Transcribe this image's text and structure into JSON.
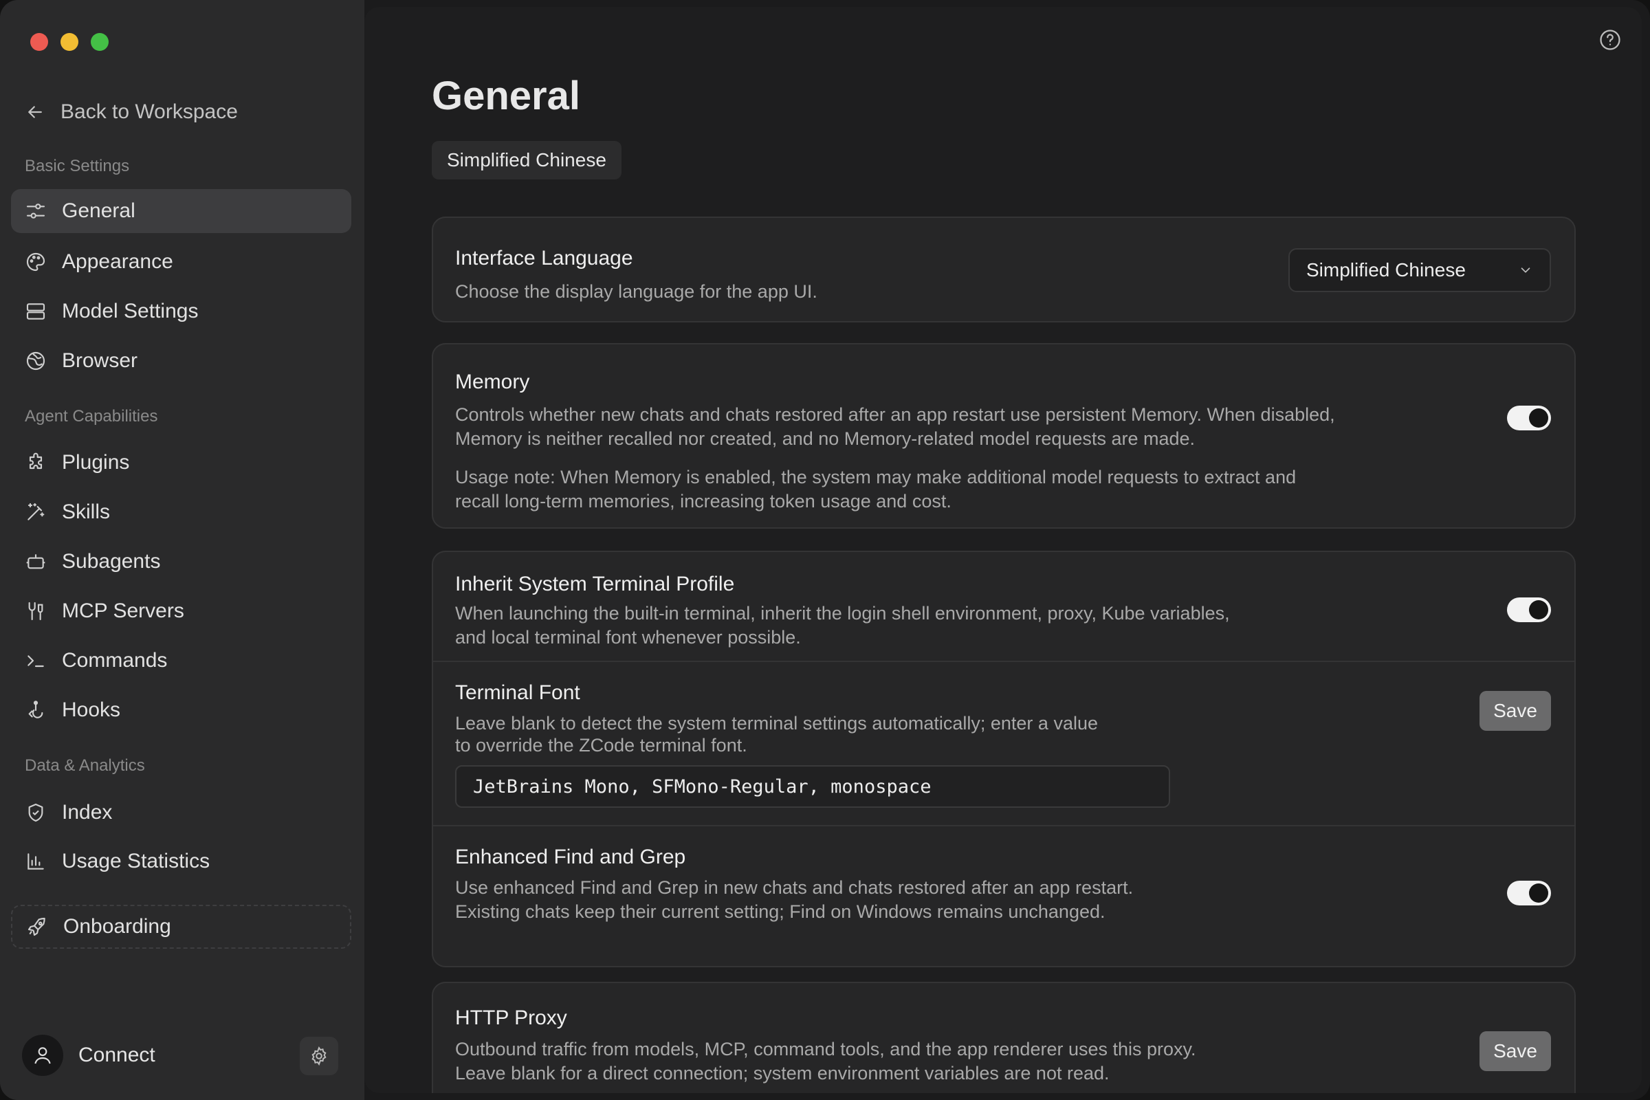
{
  "sidebar": {
    "back_label": "Back to Workspace",
    "sections": {
      "basic": "Basic Settings",
      "agent": "Agent Capabilities",
      "data": "Data & Analytics"
    },
    "items": {
      "general": "General",
      "appearance": "Appearance",
      "model_settings": "Model Settings",
      "browser": "Browser",
      "plugins": "Plugins",
      "skills": "Skills",
      "subagents": "Subagents",
      "mcp_servers": "MCP Servers",
      "commands": "Commands",
      "hooks": "Hooks",
      "index": "Index",
      "usage_statistics": "Usage Statistics",
      "onboarding": "Onboarding"
    },
    "active_item": "General",
    "connect_label": "Connect"
  },
  "main": {
    "title": "General",
    "language_chip": "Simplified Chinese",
    "interface_language": {
      "title": "Interface Language",
      "description": "Choose the display language for the app UI.",
      "selected": "Simplified Chinese"
    },
    "memory": {
      "title": "Memory",
      "description_line1": "Controls whether new chats and chats restored after an app restart use persistent Memory. When disabled,",
      "description_line2": "Memory is neither recalled nor created, and no Memory-related model requests are made.",
      "note_line1": "Usage note: When Memory is enabled, the system may make additional model requests to extract and",
      "note_line2": "recall long-term memories, increasing token usage and cost.",
      "enabled": true
    },
    "terminal_profile": {
      "title": "Inherit System Terminal Profile",
      "description_line1": "When launching the built-in terminal, inherit the login shell environment, proxy, Kube variables,",
      "description_line2": "and local terminal font whenever possible.",
      "enabled": true
    },
    "terminal_font": {
      "title": "Terminal Font",
      "description_line1": "Leave blank to detect the system terminal settings automatically; enter a value",
      "description_line2": "to override the ZCode terminal font.",
      "value": "JetBrains Mono, SFMono-Regular, monospace",
      "save_label": "Save"
    },
    "find_grep": {
      "title": "Enhanced Find and Grep",
      "description_line1": "Use enhanced Find and Grep in new chats and chats restored after an app restart.",
      "description_line2": "Existing chats keep their current setting; Find on Windows remains unchanged.",
      "enabled": true
    },
    "http_proxy": {
      "title": "HTTP Proxy",
      "description_line1": "Outbound traffic from models, MCP, command tools, and the app renderer uses this proxy.",
      "description_line2": "Leave blank for a direct connection; system environment variables are not read.",
      "save_label": "Save"
    }
  },
  "colors": {
    "sidebar_bg": "#2a2a2b",
    "main_bg": "#1e1e1f",
    "card_bg": "#262627",
    "toggle_on": "#f2f2f2",
    "traffic_red": "#ee5b52",
    "traffic_yellow": "#f2bd33",
    "traffic_green": "#44c046"
  },
  "icons": {
    "back": "arrow-left-icon",
    "general": "sliders-icon",
    "appearance": "palette-icon",
    "model_settings": "server-icon",
    "browser": "globe-icon",
    "plugins": "puzzle-icon",
    "skills": "magic-wand-icon",
    "subagents": "bot-icon",
    "mcp_servers": "plug-icon",
    "commands": "terminal-icon",
    "hooks": "hook-icon",
    "index": "shield-icon",
    "usage_statistics": "bar-chart-icon",
    "onboarding": "rocket-icon",
    "help": "help-circle-icon",
    "settings": "gear-icon",
    "user": "user-icon"
  }
}
